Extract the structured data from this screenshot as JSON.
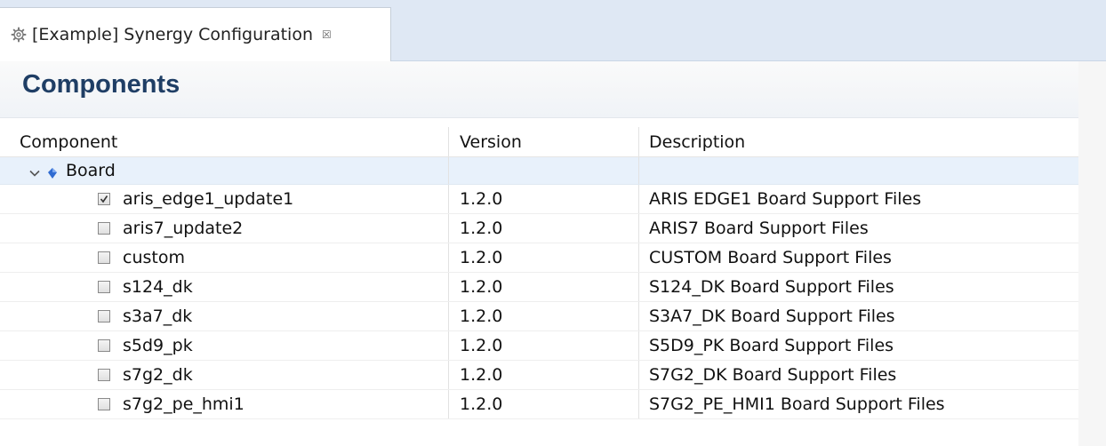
{
  "tab": {
    "icon": "gear-icon",
    "title": "[Example] Synergy Configuration",
    "close_glyph": "☒"
  },
  "section": {
    "title": "Components"
  },
  "table": {
    "columns": [
      "Component",
      "Version",
      "Description"
    ],
    "group": {
      "label": "Board",
      "icon": "board-icon",
      "expanded": true
    },
    "rows": [
      {
        "name": "aris_edge1_update1",
        "version": "1.2.0",
        "description": "ARIS EDGE1 Board Support Files",
        "checked": true
      },
      {
        "name": "aris7_update2",
        "version": "1.2.0",
        "description": "ARIS7 Board Support Files",
        "checked": false
      },
      {
        "name": "custom",
        "version": "1.2.0",
        "description": "CUSTOM Board Support Files",
        "checked": false
      },
      {
        "name": "s124_dk",
        "version": "1.2.0",
        "description": "S124_DK Board Support Files",
        "checked": false
      },
      {
        "name": "s3a7_dk",
        "version": "1.2.0",
        "description": "S3A7_DK Board Support Files",
        "checked": false
      },
      {
        "name": "s5d9_pk",
        "version": "1.2.0",
        "description": "S5D9_PK Board Support Files",
        "checked": false
      },
      {
        "name": "s7g2_dk",
        "version": "1.2.0",
        "description": "S7G2_DK Board Support Files",
        "checked": false
      },
      {
        "name": "s7g2_pe_hmi1",
        "version": "1.2.0",
        "description": "S7G2_PE_HMI1 Board Support Files",
        "checked": false
      }
    ]
  },
  "colors": {
    "title_blue": "#1f3e65",
    "tabbar_bg": "#dfe8f4",
    "group_row_bg": "#e8f1fb"
  }
}
